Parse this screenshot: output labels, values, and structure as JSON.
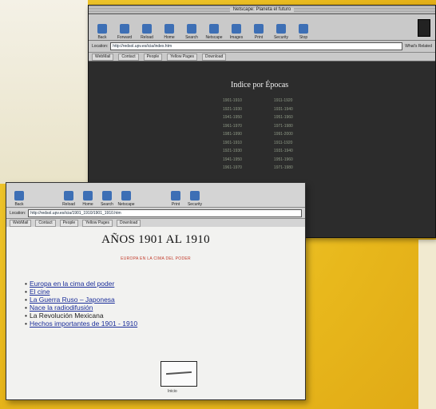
{
  "back_window": {
    "title": "Netscape: Planeta el futuro",
    "toolbar": [
      {
        "label": "Back",
        "icon": "back-arrow-icon"
      },
      {
        "label": "Forward",
        "icon": "forward-arrow-icon"
      },
      {
        "label": "Reload",
        "icon": "reload-icon"
      },
      {
        "label": "Home",
        "icon": "home-icon"
      },
      {
        "label": "Search",
        "icon": "search-icon"
      },
      {
        "label": "Netscape",
        "icon": "netscape-icon"
      },
      {
        "label": "Images",
        "icon": "images-icon"
      },
      {
        "label": "Print",
        "icon": "print-icon"
      },
      {
        "label": "Security",
        "icon": "lock-icon"
      },
      {
        "label": "Stop",
        "icon": "stop-icon"
      }
    ],
    "location_label": "Location:",
    "url": "http://redsol.upv.es/icia/index.htm",
    "whats_related": "What's Related",
    "directory": [
      "WebMail",
      "Contact",
      "People",
      "Yellow Pages",
      "Download"
    ],
    "heading": "Indice por Épocas",
    "rows": [
      [
        "1901-1910",
        "1911-1920"
      ],
      [
        "1921-1930",
        "1931-1940"
      ],
      [
        "1941-1950",
        "1951-1960"
      ],
      [
        "1961-1970",
        "1971-1980"
      ],
      [
        "1981-1990",
        "1991-2000"
      ],
      [
        "1901-1910",
        "1911-1920"
      ],
      [
        "1921-1930",
        "1931-1940"
      ],
      [
        "1941-1950",
        "1951-1960"
      ],
      [
        "1961-1970",
        "1971-1980"
      ]
    ]
  },
  "front_window": {
    "toolbar": [
      {
        "label": "Back",
        "icon": "back-arrow-icon"
      },
      {
        "label": "Reload",
        "icon": "reload-icon"
      },
      {
        "label": "Home",
        "icon": "home-icon"
      },
      {
        "label": "Search",
        "icon": "search-icon"
      },
      {
        "label": "Netscape",
        "icon": "netscape-icon"
      },
      {
        "label": "Print",
        "icon": "print-icon"
      },
      {
        "label": "Security",
        "icon": "lock-icon"
      }
    ],
    "location_label": "Location:",
    "url": "http://redsol.upv.es/icia/1901_1910/1901_1910.htm",
    "directory": [
      "WebMail",
      "Contact",
      "People",
      "Yellow Pages",
      "Download"
    ],
    "page_title": "AÑOS 1901 AL 1910",
    "subtitle": "EUROPA EN LA CIMA DEL PODER",
    "links": [
      {
        "text": "Europa en la cima del poder",
        "is_link": true
      },
      {
        "text": "El cine",
        "is_link": true
      },
      {
        "text": "La Guerra Ruso – Japonesa",
        "is_link": true
      },
      {
        "text": "Nace la radiodifusión",
        "is_link": true
      },
      {
        "text": "La Revolución Mexicana",
        "is_link": false
      },
      {
        "text": "Hechos importantes de 1901 - 1910",
        "is_link": true
      }
    ],
    "image_caption": "Inicio"
  }
}
